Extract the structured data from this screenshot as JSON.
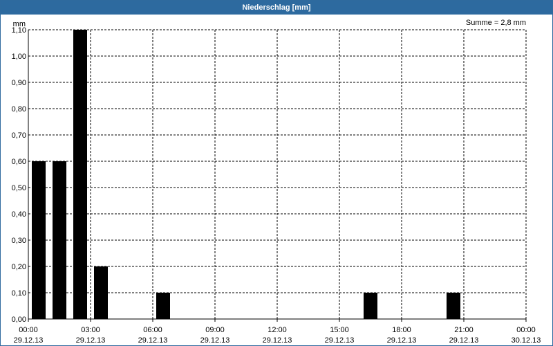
{
  "window": {
    "title": "Niederschlag [mm]"
  },
  "colors": {
    "titlebar": "#2d6a9f",
    "bars": "#000000",
    "grid": "#000000"
  },
  "chart_data": {
    "type": "bar",
    "title": "Niederschlag [mm]",
    "ylabel": "mm",
    "annotation": "Summe = 2,8 mm",
    "ylim": [
      0,
      1.1
    ],
    "grid": true,
    "y_ticks": [
      "0,00",
      "0,10",
      "0,20",
      "0,30",
      "0,40",
      "0,50",
      "0,60",
      "0,70",
      "0,80",
      "0,90",
      "1,00",
      "1,10"
    ],
    "x_ticks": [
      {
        "time": "00:00",
        "date": "29.12.13"
      },
      {
        "time": "03:00",
        "date": "29.12.13"
      },
      {
        "time": "06:00",
        "date": "29.12.13"
      },
      {
        "time": "09:00",
        "date": "29.12.13"
      },
      {
        "time": "12:00",
        "date": "29.12.13"
      },
      {
        "time": "15:00",
        "date": "29.12.13"
      },
      {
        "time": "18:00",
        "date": "29.12.13"
      },
      {
        "time": "21:00",
        "date": "29.12.13"
      },
      {
        "time": "00:00",
        "date": "30.12.13"
      }
    ],
    "bars": [
      {
        "hour": 0,
        "value": 0.6
      },
      {
        "hour": 1,
        "value": 0.6
      },
      {
        "hour": 2,
        "value": 1.1
      },
      {
        "hour": 3,
        "value": 0.2
      },
      {
        "hour": 6,
        "value": 0.1
      },
      {
        "hour": 16,
        "value": 0.1
      },
      {
        "hour": 20,
        "value": 0.1
      }
    ]
  }
}
